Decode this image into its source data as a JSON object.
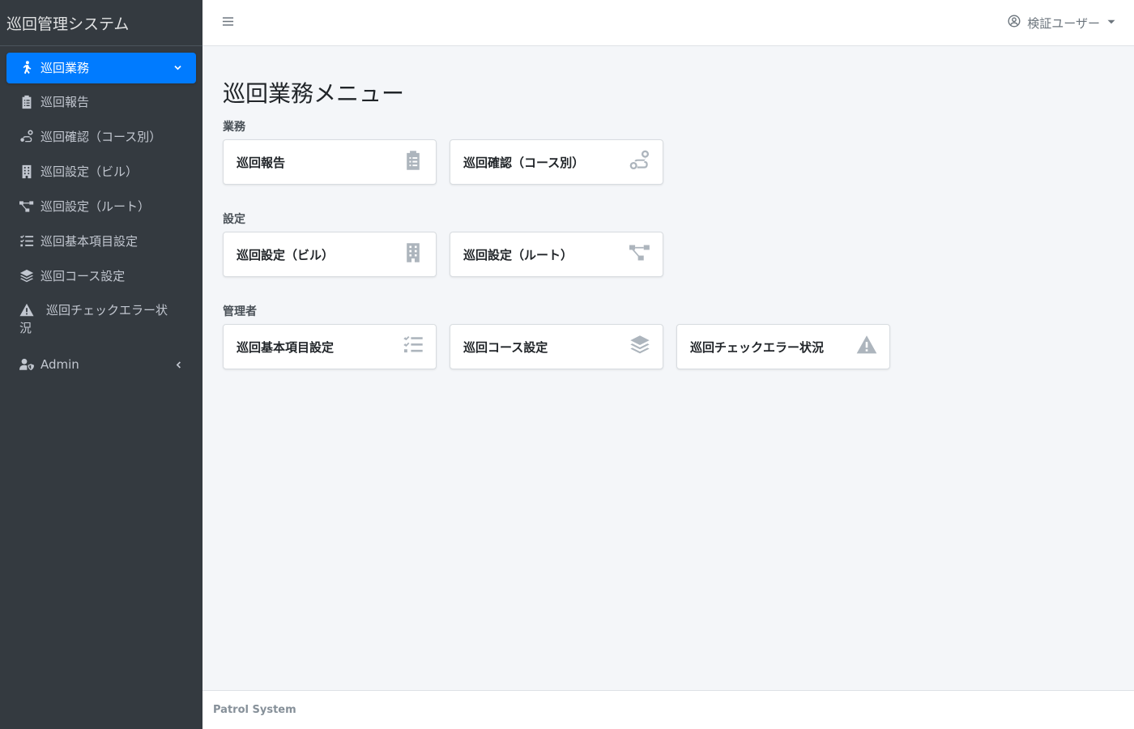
{
  "app": {
    "title": "巡回管理システム"
  },
  "sidebar": {
    "items": [
      {
        "label": "巡回業務",
        "icon": "walking-icon",
        "active": true
      },
      {
        "label": "巡回報告",
        "icon": "clipboard-list-icon"
      },
      {
        "label": "巡回確認（コース別）",
        "icon": "route-icon"
      },
      {
        "label": "巡回設定（ビル）",
        "icon": "building-icon"
      },
      {
        "label": "巡回設定（ルート）",
        "icon": "project-diagram-icon"
      },
      {
        "label": "巡回基本項目設定",
        "icon": "tasks-icon"
      },
      {
        "label": "巡回コース設定",
        "icon": "layer-group-icon"
      },
      {
        "label": "巡回チェックエラー状況",
        "icon": "warning-icon"
      },
      {
        "label": "Admin",
        "icon": "user-shield-icon"
      }
    ]
  },
  "header": {
    "user_label": "検証ユーザー"
  },
  "main": {
    "page_title": "巡回業務メニュー",
    "sections": [
      {
        "title": "業務",
        "cards": [
          {
            "label": "巡回報告",
            "icon": "clipboard-list-icon"
          },
          {
            "label": "巡回確認（コース別）",
            "icon": "route-icon"
          }
        ]
      },
      {
        "title": "設定",
        "cards": [
          {
            "label": "巡回設定（ビル）",
            "icon": "building-icon"
          },
          {
            "label": "巡回設定（ルート）",
            "icon": "project-diagram-icon"
          }
        ]
      },
      {
        "title": "管理者",
        "cards": [
          {
            "label": "巡回基本項目設定",
            "icon": "tasks-icon"
          },
          {
            "label": "巡回コース設定",
            "icon": "layer-group-icon"
          },
          {
            "label": "巡回チェックエラー状況",
            "icon": "warning-icon"
          }
        ]
      }
    ]
  },
  "footer": {
    "text": "Patrol System"
  },
  "colors": {
    "sidebar_bg": "#343a40",
    "accent": "#007bff",
    "content_bg": "#f4f6f9",
    "icon_gray": "#adb5bd"
  }
}
